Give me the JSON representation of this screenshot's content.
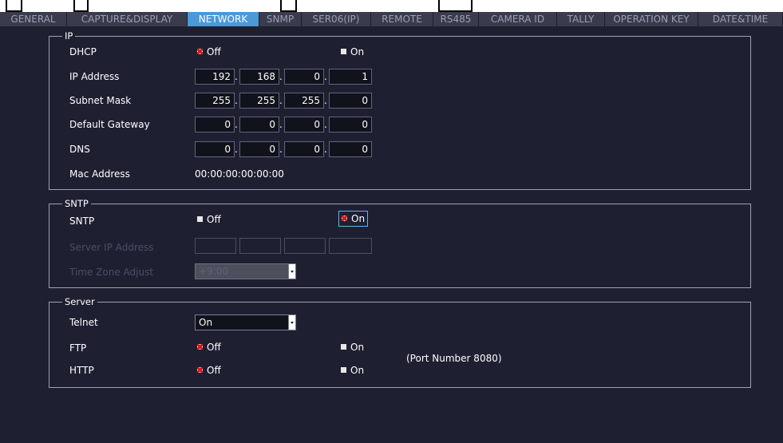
{
  "tabs": [
    {
      "label": "GENERAL",
      "active": false
    },
    {
      "label": "CAPTURE&DISPLAY",
      "active": false
    },
    {
      "label": "NETWORK",
      "active": true
    },
    {
      "label": "SNMP",
      "active": false
    },
    {
      "label": "SER06(IP)",
      "active": false
    },
    {
      "label": "REMOTE",
      "active": false
    },
    {
      "label": "RS485",
      "active": false
    },
    {
      "label": "CAMERA ID",
      "active": false
    },
    {
      "label": "TALLY",
      "active": false
    },
    {
      "label": "OPERATION KEY",
      "active": false
    },
    {
      "label": "DATE&TIME",
      "active": false
    }
  ],
  "ip": {
    "legend": "IP",
    "dhcp_label": "DHCP",
    "dhcp_off": "Off",
    "dhcp_on": "On",
    "dhcp_selected": "Off",
    "ip_label": "IP Address",
    "ip": [
      "192",
      "168",
      "0",
      "1"
    ],
    "subnet_label": "Subnet Mask",
    "subnet": [
      "255",
      "255",
      "255",
      "0"
    ],
    "gateway_label": "Default Gateway",
    "gateway": [
      "0",
      "0",
      "0",
      "0"
    ],
    "dns_label": "DNS",
    "dns": [
      "0",
      "0",
      "0",
      "0"
    ],
    "mac_label": "Mac Address",
    "mac": "00:00:00:00:00:00",
    "octet_separator": "."
  },
  "sntp": {
    "legend": "SNTP",
    "sntp_label": "SNTP",
    "off": "Off",
    "on": "On",
    "selected": "On",
    "server_label": "Server IP Address",
    "timezone_label": "Time Zone Adjust",
    "timezone_value": "+9:00"
  },
  "server": {
    "legend": "Server",
    "telnet_label": "Telnet",
    "telnet_value": "On",
    "ftp_label": "FTP",
    "ftp_off": "Off",
    "ftp_on": "On",
    "http_label": "HTTP",
    "http_off": "Off",
    "http_on": "On",
    "port_note": "(Port Number 8080)"
  },
  "colors": {
    "panel_bg": "#1e2032",
    "tab_bg": "#3a3b4c",
    "tab_active": "#4a9ad9",
    "check_red": "#d21e1e"
  }
}
